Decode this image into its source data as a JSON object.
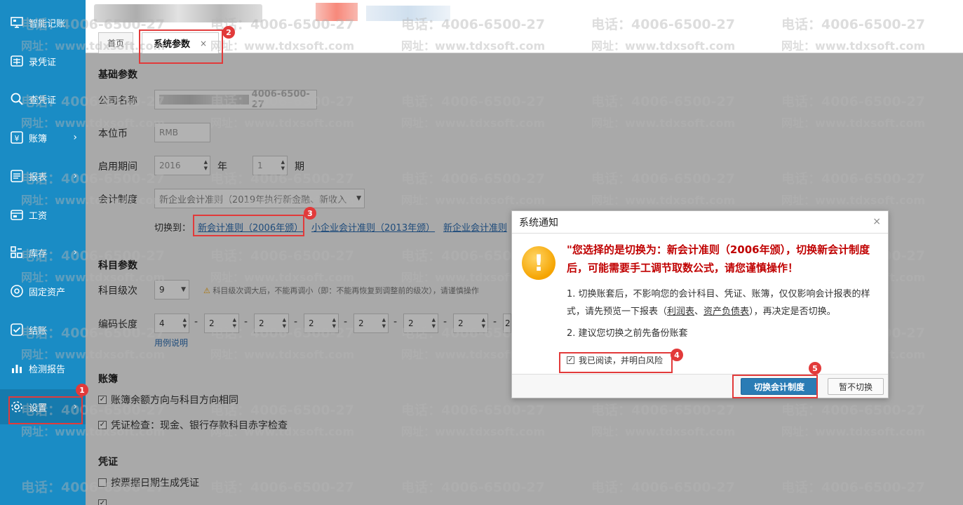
{
  "sidebar": {
    "items": [
      {
        "label": "智能记账",
        "icon": "monitor-icon",
        "has_chevron": false
      },
      {
        "label": "录凭证",
        "icon": "voucher-icon",
        "has_chevron": false
      },
      {
        "label": "查凭证",
        "icon": "search-icon",
        "has_chevron": false
      },
      {
        "label": "账簿",
        "icon": "yen-icon",
        "has_chevron": true
      },
      {
        "label": "报表",
        "icon": "report-icon",
        "has_chevron": true
      },
      {
        "label": "工资",
        "icon": "wallet-icon",
        "has_chevron": false
      },
      {
        "label": "库存",
        "icon": "grid-icon",
        "has_chevron": true
      },
      {
        "label": "固定资产",
        "icon": "asset-icon",
        "has_chevron": false
      },
      {
        "label": "结账",
        "icon": "check-icon",
        "has_chevron": false
      },
      {
        "label": "检测报告",
        "icon": "chart-icon",
        "has_chevron": false
      },
      {
        "label": "设置",
        "icon": "gear-icon",
        "has_chevron": true,
        "active": true
      }
    ],
    "chevron": "›"
  },
  "tabs": {
    "home": "首页",
    "active": "系统参数",
    "close": "×"
  },
  "basic": {
    "section": "基础参数",
    "company_label": "公司名称",
    "company_value_suffix": "4006-6500-27",
    "currency_label": "本位币",
    "currency_value": "RMB",
    "start_label": "启用期间",
    "year_value": "2016",
    "year_unit": "年",
    "period_value": "1",
    "period_unit": "期",
    "standard_label": "会计制度",
    "standard_value": "新企业会计准则（2019年执行新金融、新收入",
    "switch_label": "切换到：",
    "switch_opt1": "新会计准则（2006年颁）",
    "switch_opt2": "小企业会计准则（2013年颁）",
    "switch_opt3": "新企业会计准则"
  },
  "subject": {
    "section": "科目参数",
    "level_label": "科目级次",
    "level_value": "9",
    "level_warning": "科目级次调大后，不能再调小（即：不能再恢复到调整前的级次），请谨慎操作",
    "code_label": "编码长度",
    "code_values": [
      "4",
      "2",
      "2",
      "2",
      "2",
      "2",
      "2",
      "2"
    ],
    "code_sep": "-",
    "example_link": "用例说明"
  },
  "ledger": {
    "section": "账簿",
    "opt1": "账簿余额方向与科目方向相同",
    "opt2": "凭证检查：现金、银行存款科目赤字检查"
  },
  "voucher": {
    "section": "凭证",
    "opt1": "按票据日期生成凭证"
  },
  "watermark": {
    "phone": "电话：4006-6500-27",
    "site": "网址：www.tdxsoft.com"
  },
  "dialog": {
    "title": "系统通知",
    "close": "×",
    "icon_glyph": "!",
    "headline": "\"您选择的是切换为：新会计准则（2006年颁），切换新会计制度后，可能需要手工调节取数公式，请您谨慎操作！",
    "p1_pre": "1. 切换账套后，不影响您的会计科目、凭证、账簿，仅仅影响会计报表的样式，请先预览一下报表（",
    "p1_link1": "利润表",
    "p1_sep": "、",
    "p1_link2": "资产负债表",
    "p1_post": "），再决定是否切换。",
    "p2": "2. 建议您切换之前先备份账套",
    "checkbox_label": "我已阅读，并明白风险",
    "confirm_button": "切换会计制度",
    "cancel_button": "暂不切换"
  },
  "annotations": [
    "1",
    "2",
    "3",
    "4",
    "5"
  ],
  "colors": {
    "sidebar": "#1a8cc5",
    "annotation": "#e23a3a",
    "warning_text": "#c00000",
    "primary_button": "#2a7cb5"
  }
}
